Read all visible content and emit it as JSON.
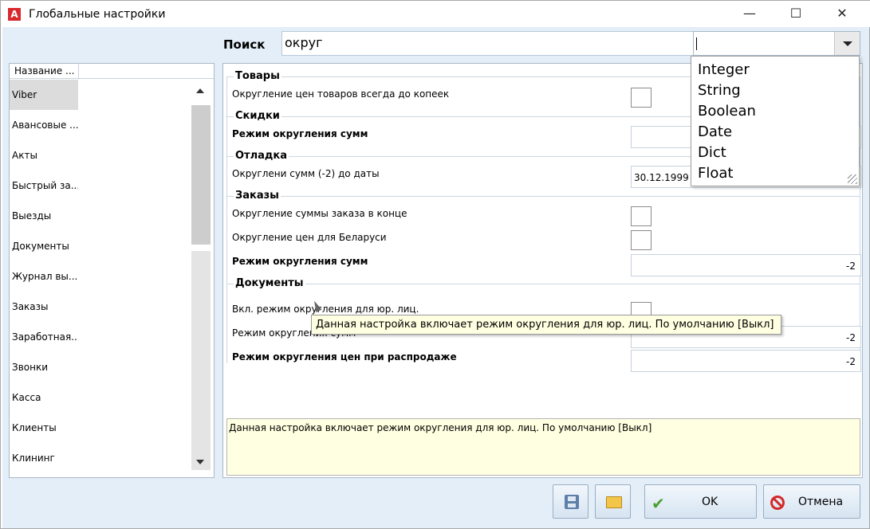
{
  "window": {
    "title": "Глобальные настройки",
    "icon": "app-logo-a",
    "minimize": "—",
    "maximize": "☐",
    "close": "✕"
  },
  "search": {
    "label": "Поиск",
    "value": "округ",
    "type_value": ""
  },
  "type_options": [
    "Integer",
    "String",
    "Boolean",
    "Date",
    "Dict",
    "Float"
  ],
  "sidebar": {
    "header": "Название ...",
    "items": [
      "Viber",
      "Авансовые ...",
      "Акты",
      "Быстрый за...",
      "Выезды",
      "Документы",
      "Журнал вы...",
      "Заказы",
      "Заработная...",
      "Звонки",
      "Касса",
      "Клиенты",
      "Клининг"
    ]
  },
  "groups": {
    "tovary": {
      "title": "Товары",
      "r1": "Округление цен товаров всегда до копеек"
    },
    "skidki": {
      "title": "Скидки",
      "r1": "Режим округления сумм"
    },
    "otladka": {
      "title": "Отладка",
      "r1": "Округлени сумм (-2) до даты",
      "r1_value": "30.12.1999"
    },
    "zakazy": {
      "title": "Заказы",
      "r1": "Округление суммы заказа в конце",
      "r2": "Округление цен для Беларуси",
      "r3": "Режим округления сумм",
      "r3_value": "-2"
    },
    "dokumenty": {
      "title": "Документы",
      "r1": "Вкл. режим округления для юр. лиц.",
      "r2": "Режим округления сумм",
      "r2_value": "-2",
      "r3": "Режим округления цен при распродаже",
      "r3_value": "-2"
    }
  },
  "tooltip": "Данная настройка включает режим округления для юр. лиц. По умолчанию [Выкл]",
  "description": "Данная настройка включает режим округления для юр. лиц. По умолчанию [Выкл]",
  "buttons": {
    "ok": "OK",
    "cancel": "Отмена"
  },
  "colors": {
    "background": "#e3eef8",
    "tooltip_bg": "#ffffe1",
    "accent_red": "#d9272e"
  }
}
